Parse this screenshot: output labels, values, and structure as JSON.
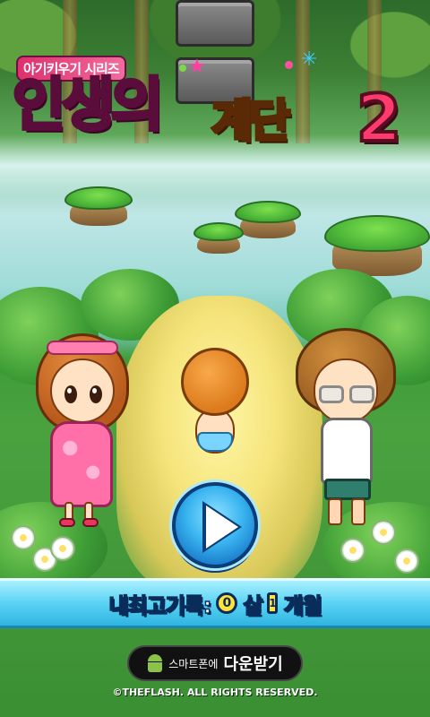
{
  "title": {
    "series": "아기키우기 시리즈",
    "part1": "인생의",
    "part2": "계단",
    "part3": "2"
  },
  "play_button": {
    "icon": "play-icon"
  },
  "record": {
    "label": "내최고기록:",
    "years": "0",
    "years_unit": "살",
    "months": "1",
    "months_unit": "개월"
  },
  "download": {
    "icon": "android-icon",
    "prefix": "스마트폰에",
    "label": "다운받기"
  },
  "copyright": "©THEFLASH. ALL RIGHTS RESERVED."
}
